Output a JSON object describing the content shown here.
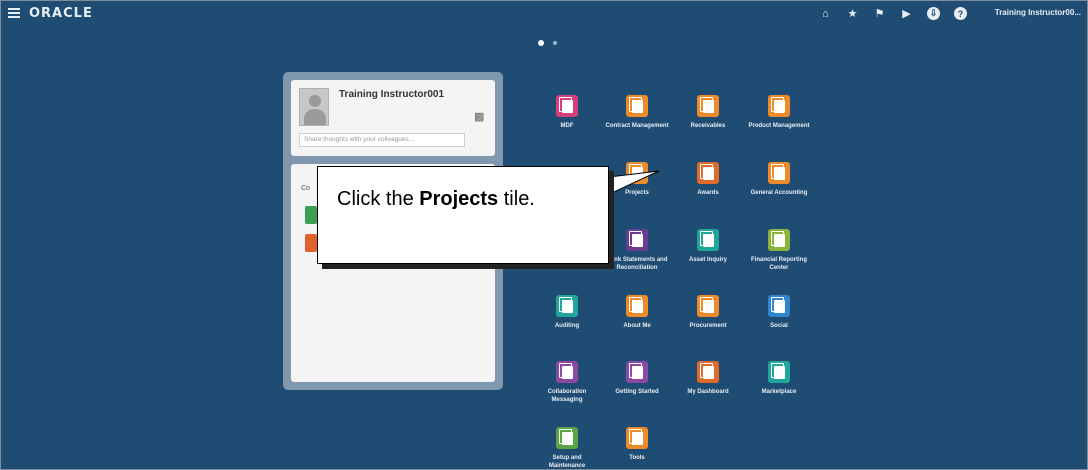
{
  "header": {
    "brand": "ORACLE",
    "user_name": "Training Instructor00...",
    "icons": [
      "home-icon",
      "favorites-icon",
      "notifications-icon",
      "watchlist-icon",
      "settings-icon",
      "help-icon"
    ]
  },
  "pagination": {
    "active": 1,
    "count": 2
  },
  "profile": {
    "name": "Training Instructor001",
    "share_placeholder": "Share thoughts with your colleagues..."
  },
  "content_card": {
    "label": "Co"
  },
  "callout": {
    "text_before": "Click the ",
    "text_bold": "Projects",
    "text_after": " tile."
  },
  "tiles": [
    {
      "label": "MDF",
      "color": "#d63e7c"
    },
    {
      "label": "Contract Management",
      "color": "#ed8a29"
    },
    {
      "label": "Receivables",
      "color": "#ed8a29"
    },
    {
      "label": "Product Management",
      "color": "#ed8a29"
    },
    {
      "label": "Projects",
      "color": "#ed8a29"
    },
    {
      "label": "Awards",
      "color": "#e06a2b"
    },
    {
      "label": "General Accounting",
      "color": "#ed8a29"
    },
    {
      "label": "Bank Statements and Reconciliation",
      "color": "#6b3c8f"
    },
    {
      "label": "Asset Inquiry",
      "color": "#22a59b"
    },
    {
      "label": "Financial Reporting Center",
      "color": "#8ab43a"
    },
    {
      "label": "Auditing",
      "color": "#22a59b"
    },
    {
      "label": "About Me",
      "color": "#ed8a29"
    },
    {
      "label": "Procurement",
      "color": "#ed8a29"
    },
    {
      "label": "Social",
      "color": "#2f86cf"
    },
    {
      "label": "Collaboration Messaging",
      "color": "#8a4aa3"
    },
    {
      "label": "Getting Started",
      "color": "#8a4aa3"
    },
    {
      "label": "My Dashboard",
      "color": "#e06a2b"
    },
    {
      "label": "Marketplace",
      "color": "#22a59b"
    },
    {
      "label": "Setup and Maintenance",
      "color": "#5aa644"
    },
    {
      "label": "Tools",
      "color": "#ed8a29"
    }
  ]
}
